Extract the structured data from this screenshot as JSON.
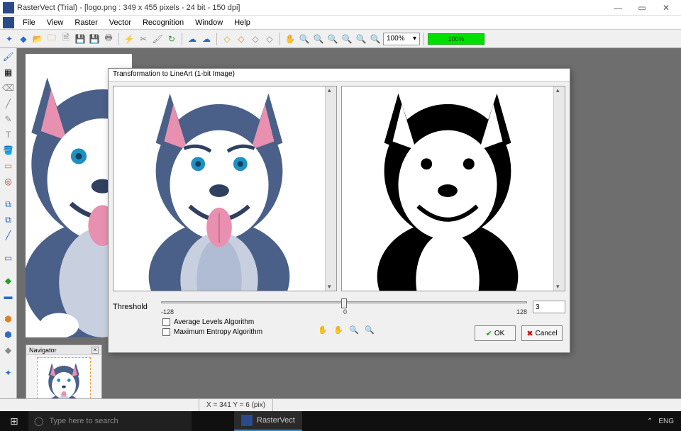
{
  "titlebar": {
    "text": "RasterVect (Trial) - [logo.png : 349 x 455 pixels - 24 bit - 150 dpi]"
  },
  "menu": {
    "items": [
      "File",
      "View",
      "Raster",
      "Vector",
      "Recognition",
      "Window",
      "Help"
    ],
    "underlines": [
      "F",
      "V",
      "R",
      "e",
      "e",
      "W",
      "H"
    ]
  },
  "toolbar": {
    "zoom": "100%",
    "zoom_arrow": "▾",
    "progress": "100%"
  },
  "dialog": {
    "title": "Transformation to LineArt (1-bit Image)",
    "threshold_label": "Threshold",
    "slider_min": "-128",
    "slider_mid": "0",
    "slider_max": "128",
    "threshold_value": "3",
    "algo1": "Average Levels Algorithm",
    "algo2": "Maximum Entropy Algorithm",
    "ok": "OK",
    "cancel": "Cancel"
  },
  "navigator": {
    "title": "Navigator"
  },
  "statusbar": {
    "coords": "X = 341   Y = 6 (pix)"
  },
  "taskbar": {
    "search_placeholder": "Type here to search",
    "app": "RasterVect",
    "lang": "ENG",
    "chev": "⌃"
  }
}
